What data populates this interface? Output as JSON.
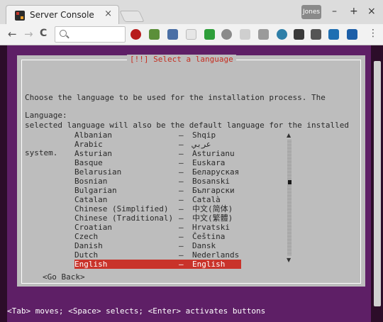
{
  "browser": {
    "tab_title": "Server Console",
    "tab_close": "×",
    "profile_label": "Jones",
    "window_buttons": {
      "minimize": "–",
      "maximize": "+",
      "close": "×"
    },
    "nav": {
      "back": "←",
      "forward": "→",
      "reload": "C",
      "menu": "⋮"
    },
    "omnibox_value": "",
    "extension_icons": [
      "ublock-icon",
      "upload-icon",
      "stack-icon",
      "camera-icon",
      "checkmark-icon",
      "clock-icon",
      "page-icon",
      "cursor-icon",
      "cloud-icon",
      "screen-icon",
      "columns-icon",
      "slash-icon",
      "plane-icon"
    ]
  },
  "installer": {
    "title": "[!!] Select a language",
    "intro_lines": [
      "Choose the language to be used for the installation process. The",
      "selected language will also be the default language for the installed",
      "system."
    ],
    "language_heading": "Language:",
    "languages": [
      {
        "name": "Albanian",
        "native": "Shqip"
      },
      {
        "name": "Arabic",
        "native": "عربي"
      },
      {
        "name": "Asturian",
        "native": "Asturianu"
      },
      {
        "name": "Basque",
        "native": "Euskara"
      },
      {
        "name": "Belarusian",
        "native": "Беларуская"
      },
      {
        "name": "Bosnian",
        "native": "Bosanski"
      },
      {
        "name": "Bulgarian",
        "native": "Български"
      },
      {
        "name": "Catalan",
        "native": "Català"
      },
      {
        "name": "Chinese (Simplified)",
        "native": "中文(简体)"
      },
      {
        "name": "Chinese (Traditional)",
        "native": "中文(繁體)"
      },
      {
        "name": "Croatian",
        "native": "Hrvatski"
      },
      {
        "name": "Czech",
        "native": "Čeština"
      },
      {
        "name": "Danish",
        "native": "Dansk"
      },
      {
        "name": "Dutch",
        "native": "Nederlands"
      },
      {
        "name": "English",
        "native": "English"
      }
    ],
    "selected_index": 14,
    "separator": "–",
    "go_back": "<Go Back>",
    "status_bar": "<Tab> moves; <Space> selects; <Enter> activates buttons"
  },
  "colors": {
    "terminal_bg": "#5e1f66",
    "dialog_bg": "#bdbdbd",
    "title_red": "#c62d1f",
    "selection_red": "#c9332a"
  }
}
